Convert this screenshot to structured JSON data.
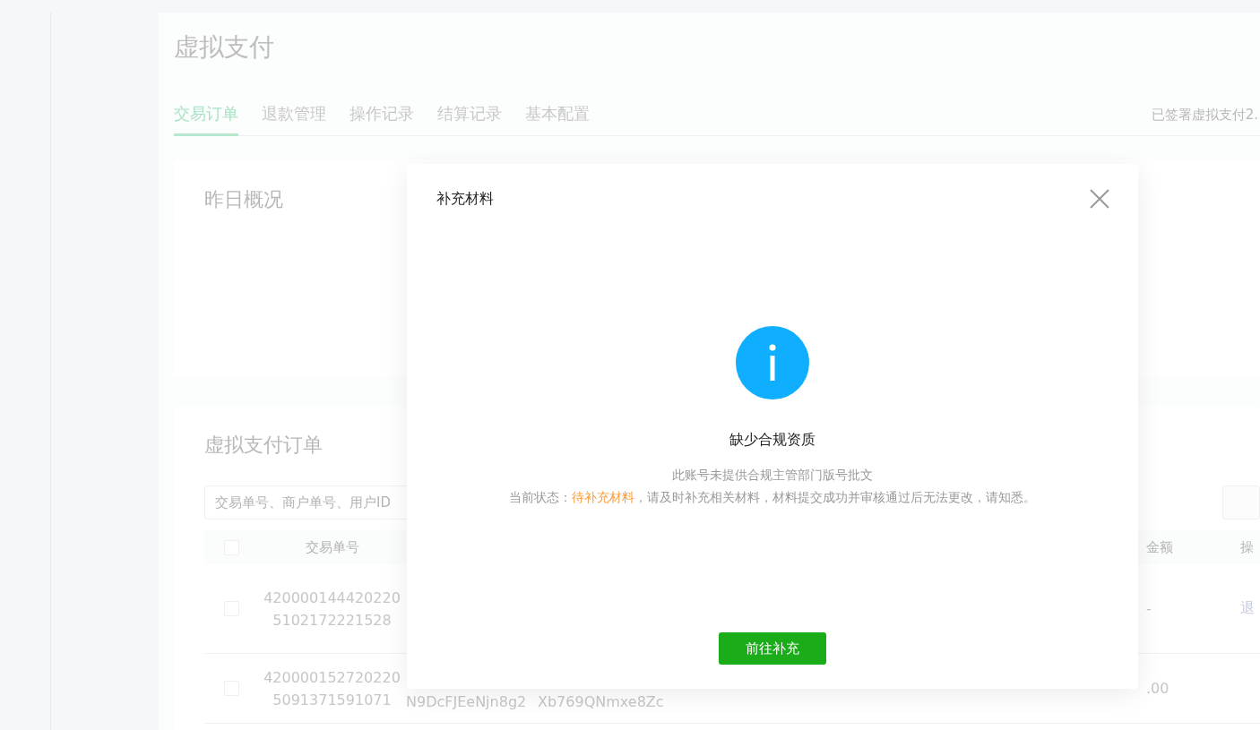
{
  "page": {
    "title": "虚拟支付",
    "signed_note": "已签署虚拟支付2."
  },
  "tabs": [
    {
      "label": "交易订单",
      "selected": true
    },
    {
      "label": "退款管理",
      "selected": false
    },
    {
      "label": "操作记录",
      "selected": false
    },
    {
      "label": "结算记录",
      "selected": false
    },
    {
      "label": "基本配置",
      "selected": false
    }
  ],
  "overview_card": {
    "title": "昨日概况"
  },
  "orders_card": {
    "title": "虚拟支付订单",
    "search": {
      "placeholder": "交易单号、商户单号、用户ID"
    },
    "table": {
      "all_checked": false,
      "columns": [
        {
          "label": "交易单号"
        },
        {
          "label": "金额"
        },
        {
          "label": "操"
        }
      ],
      "rows": [
        {
          "checked": false,
          "order_no": "4200001444202205102172221528",
          "amount": "-",
          "action": "退"
        },
        {
          "checked": false,
          "order_no": "4200001527202205091371591071",
          "column_2": "N9DcFJEeNjn8g2",
          "column_3": "Xb769QNmxe8Zc",
          "amount": ".00"
        }
      ]
    }
  },
  "dialog": {
    "title": "补充材料",
    "heading": "缺少合规资质",
    "message": "此账号未提供合规主管部门版号批文",
    "status_label": "当前状态：",
    "status_value": "待补充材料",
    "status_note": "，请及时补充相关材料，材料提交成功并审核通过后无法更改，请知悉。",
    "button": "前往补充"
  }
}
